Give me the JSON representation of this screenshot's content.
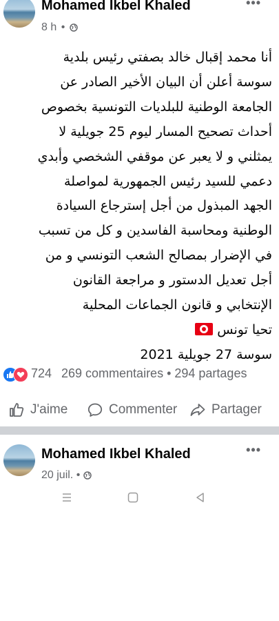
{
  "post": {
    "author": "Mohamed Ikbel Khaled",
    "time": "8 h",
    "separator": "•",
    "more": "•••",
    "body_lines": [
      "أنا محمد إقبال خالد بصفتي رئيس بلدية",
      "سوسة أعلن أن البيان الأخير الصادر عن",
      "الجامعة الوطنية للبلديات التونسية بخصوص",
      "أحداث تصحيح المسار ليوم 25 جويلية لا",
      "يمثلني و لا يعبر عن موقفي الشخصي وأبدي",
      "دعمي للسيد رئيس الجمهورية لمواصلة",
      "الجهد المبذول من أجل إسترجاع السيادة",
      "الوطنية ومحاسبة الفاسدين و كل من تسبب",
      "في الإضرار بمصالح الشعب التونسي و من",
      "أجل تعديل الدستور و مراجعة القانون",
      "الإنتخابي و قانون الجماعات المحلية"
    ],
    "closing": "تحيا تونس",
    "signature": "سوسة 27 جويلية 2021"
  },
  "stats": {
    "reaction_count": "724",
    "comments_shares": "269 commentaires • 294 partages"
  },
  "actions": {
    "like": "J'aime",
    "comment": "Commenter",
    "share": "Partager"
  },
  "post2": {
    "author": "Mohamed Ikbel Khaled",
    "time": "20 juil.",
    "separator": "•",
    "more": "•••"
  },
  "icons": {
    "privacy": "globe-icon",
    "like_reaction": "thumbs-up-icon",
    "love_reaction": "heart-icon",
    "flag": "tunisia-flag-icon"
  },
  "colors": {
    "secondary_text": "#65676b",
    "like_blue": "#1877f2",
    "love_red": "#f33e58",
    "separator": "#cfd2d6"
  }
}
